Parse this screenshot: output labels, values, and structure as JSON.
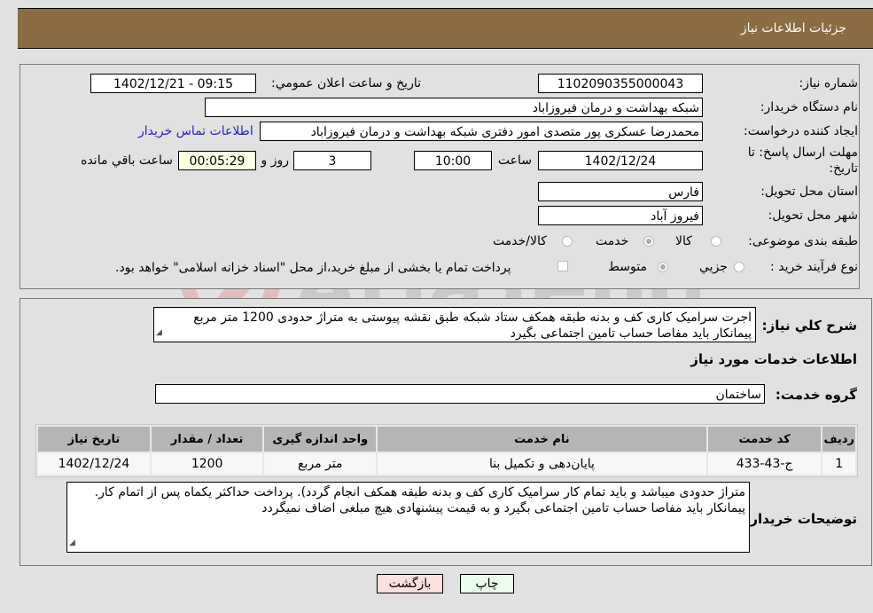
{
  "header": {
    "title": "جزئیات اطلاعات نیاز"
  },
  "form": {
    "need_number_label": "شماره نیاز:",
    "need_number": "1102090355000043",
    "announce_label": "تاریخ و ساعت اعلان عمومي:",
    "announce_value": "1402/12/21 - 09:15",
    "buyer_org_label": "نام دستگاه خریدار:",
    "buyer_org": "شبکه بهداشت و درمان فیروزاباد",
    "creator_label": "ایجاد کننده درخواست:",
    "creator": "محمدرضا عسکری پور متصدی امور دفتری شبکه بهداشت و درمان فیروزاباد",
    "contact_link": "اطلاعات تماس خریدار",
    "deadline_label_1": "مهلت ارسال پاسخ: تا",
    "deadline_label_2": "تاریخ:",
    "deadline_date": "1402/12/24",
    "time_label": "ساعت",
    "deadline_time": "10:00",
    "days": "3",
    "days_label": "روز و",
    "remaining": "00:05:29",
    "remaining_label": "ساعت باقي مانده",
    "province_label": "استان محل تحویل:",
    "province": "فارس",
    "city_label": "شهر محل تحویل:",
    "city": "فیروز آباد",
    "category_label": "طبقه بندی موضوعی:",
    "category_options": [
      {
        "label": "کالا",
        "checked": false
      },
      {
        "label": "خدمت",
        "checked": true
      },
      {
        "label": "کالا/خدمت",
        "checked": false
      }
    ],
    "process_label": "نوع فرآیند خرید :",
    "process_options": [
      {
        "label": "جزيي",
        "checked": false
      },
      {
        "label": "متوسط",
        "checked": true
      }
    ],
    "treasury_note": "پرداخت تمام یا بخشی از مبلغ خرید،از محل \"اسناد خزانه اسلامی\" خواهد بود.",
    "treasury_checked": false
  },
  "details": {
    "summary_label": "شرح کلي نیاز:",
    "summary_text": "اجرت سرامیک کاری کف و بدنه طبقه همکف ستاد شبکه طبق نقشه پیوستی به متراژ حدودی 1200 متر مربع پیمانکار باید مفاصا حساب تامین اجتماعی بگیرد",
    "services_heading": "اطلاعات خدمات مورد نیاز",
    "service_group_label": "گروه خدمت:",
    "service_group": "ساختمان",
    "table": {
      "headers": [
        "ردیف",
        "کد خدمت",
        "نام خدمت",
        "واحد اندازه گیری",
        "تعداد / مقدار",
        "تاریخ نیاز"
      ],
      "rows": [
        [
          "1",
          "ج-43-433",
          "پایان‌دهی و تکمیل بنا",
          "متر مربع",
          "1200",
          "1402/12/24"
        ]
      ]
    },
    "buyer_notes_label": "توضیحات خریدار:",
    "buyer_notes": "متراژ حدودی میباشد و باید تمام کار سرامیک کاری کف و بدنه طبقه همکف انجام گردد). پرداخت حداکثر یکماه پس از اتمام کار. پیمانکار باید مفاصا حساب تامین اجتماعی بگیرد و به قیمت پیشنهادی هیچ مبلغی اضاف نمیگردد"
  },
  "buttons": {
    "print": "چاپ",
    "back": "بازگشت"
  },
  "watermark": {
    "text": "AriaTender.neT"
  },
  "colors": {
    "header_bg": "#8c6c43",
    "link": "#2323c8",
    "back_btn": "#ffe0e0",
    "print_btn": "#eaffea",
    "remaining_bg": "#ffffe1"
  }
}
